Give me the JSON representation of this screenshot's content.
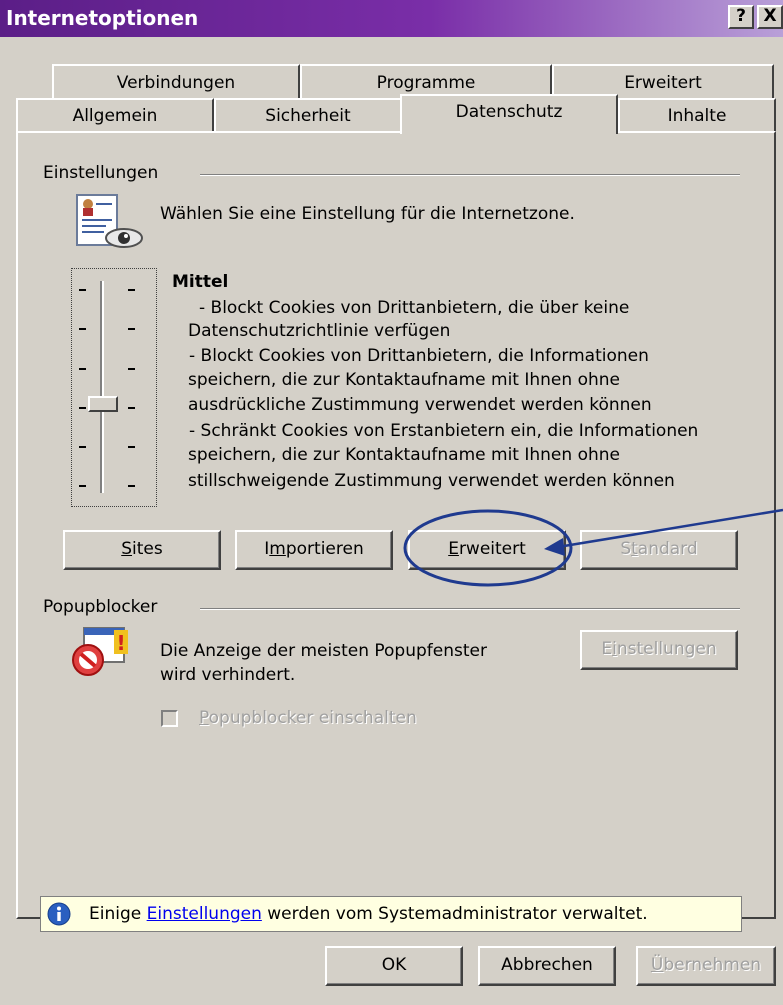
{
  "window": {
    "title": "Internetoptionen",
    "help_label": "?",
    "close_label": "X"
  },
  "tabs_row1": [
    "Verbindungen",
    "Programme",
    "Erweitert"
  ],
  "tabs_row2": [
    "Allgemein",
    "Sicherheit",
    "Datenschutz",
    "Inhalte"
  ],
  "active_tab": "Datenschutz",
  "settings": {
    "group_title": "Einstellungen",
    "description": "Wählen Sie eine Einstellung für die Internetzone.",
    "level_title": "Mittel",
    "level_lines": [
      "- Blockt Cookies von Drittanbietern, die über keine",
      "Datenschutzrichtlinie verfügen",
      "- Blockt Cookies von Drittanbietern, die Informationen",
      "speichern, die zur Kontaktaufname mit Ihnen ohne",
      "ausdrückliche Zustimmung verwendet werden können",
      "- Schränkt Cookies von Erstanbietern ein, die Informationen",
      "speichern, die zur Kontaktaufname mit Ihnen ohne",
      "stillschweigende Zustimmung verwendet werden können"
    ],
    "slider_level": "3 of 6",
    "buttons": {
      "sites_u": "S",
      "sites_rest": "ites",
      "import_pre": "I",
      "import_u": "m",
      "import_rest": "portieren",
      "advanced_u": "E",
      "advanced_rest": "rweitert",
      "default_pre": "S",
      "default_u": "t",
      "default_rest": "andard"
    }
  },
  "popup": {
    "group_title": "Popupblocker",
    "description_line1": "Die Anzeige der meisten Popupfenster",
    "description_line2": "wird verhindert.",
    "settings_pre": "E",
    "settings_u": "i",
    "settings_rest": "nstellungen",
    "checkbox_u": "P",
    "checkbox_rest": "opupblocker einschalten"
  },
  "info": {
    "prefix": "Einige ",
    "link": "Einstellungen",
    "suffix": " werden vom Systemadministrator verwaltet."
  },
  "footer": {
    "ok": "OK",
    "cancel": "Abbrechen",
    "apply_u": "Ü",
    "apply_rest": "bernehmen"
  },
  "colors": {
    "annotation": "#1f3a8f",
    "titlebar_start": "#5b1e87"
  }
}
